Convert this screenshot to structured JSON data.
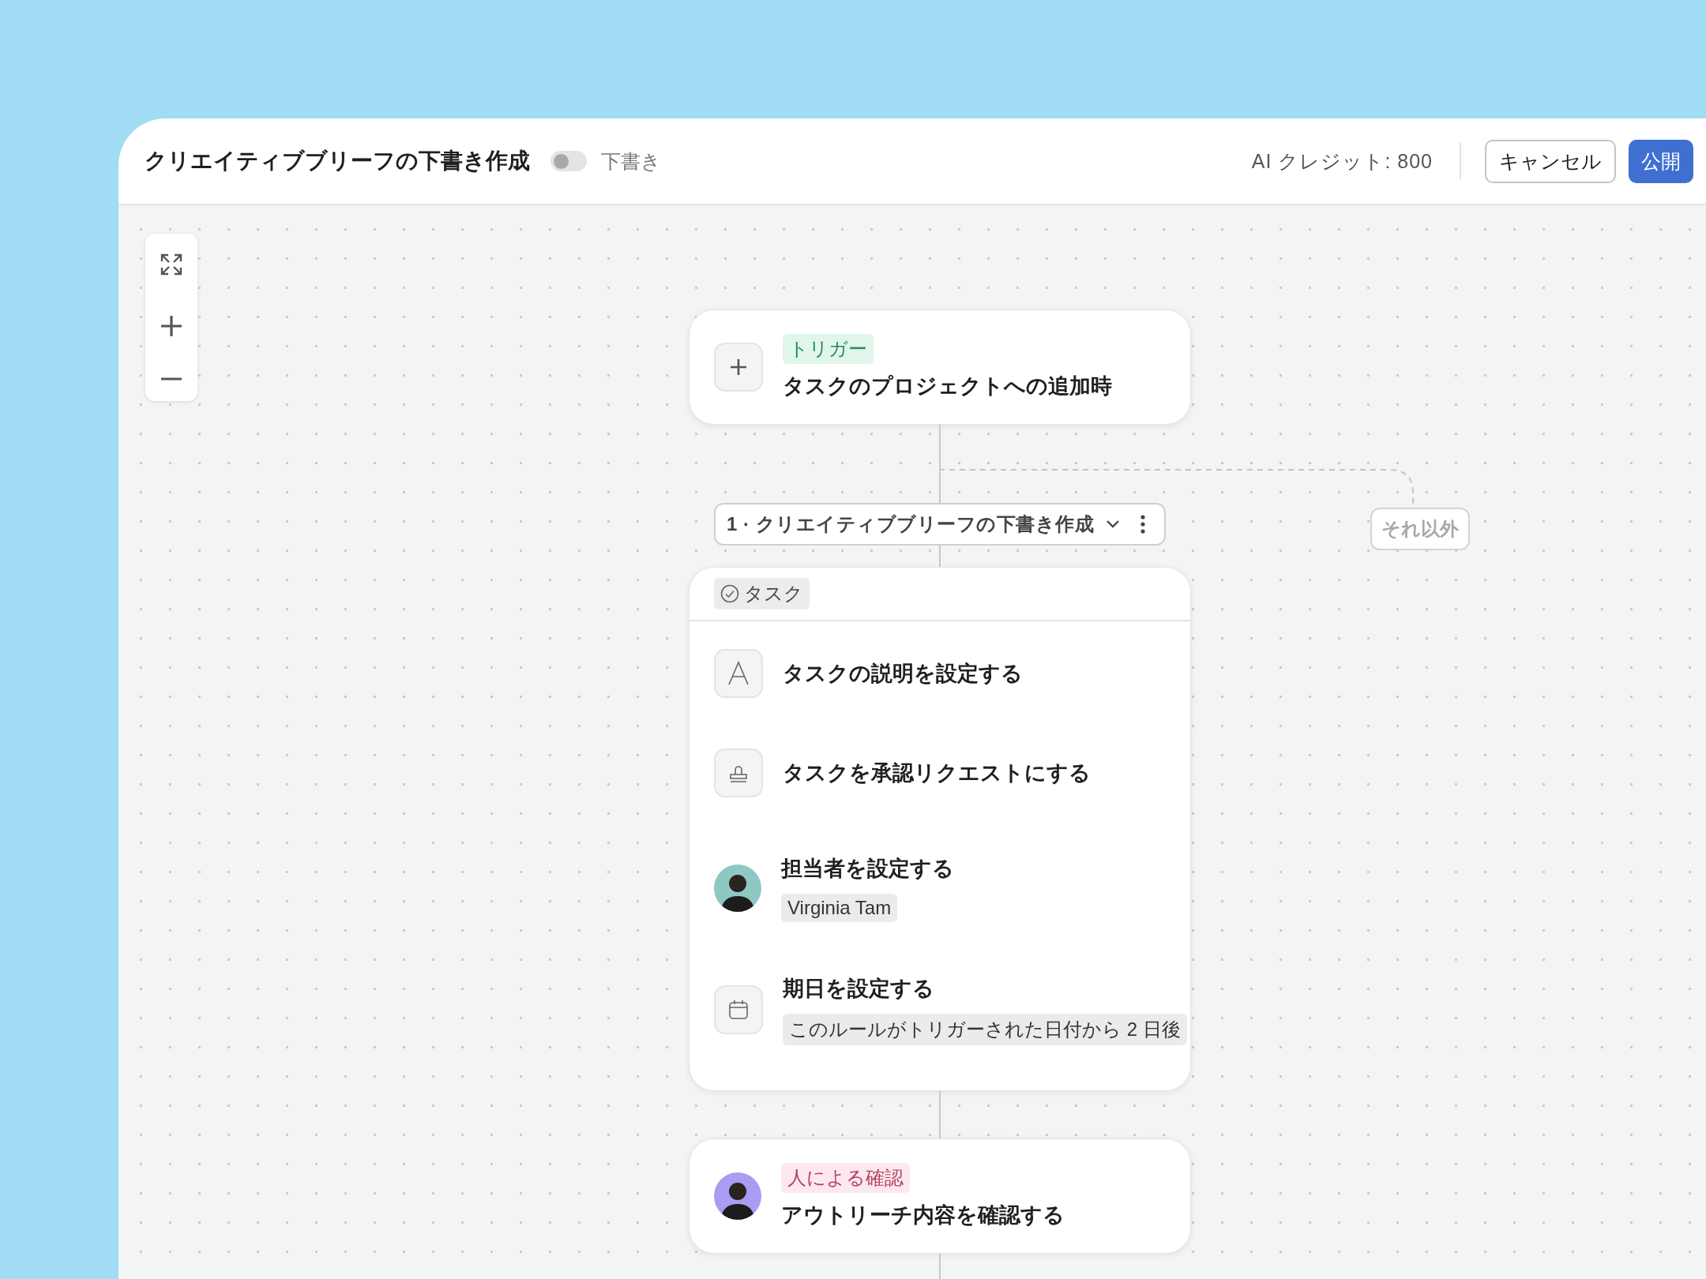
{
  "header": {
    "title": "クリエイティブブリーフの下書き作成",
    "draft_toggle": {
      "on": false
    },
    "status": "下書き",
    "credits": "AI クレジット: 800",
    "buttons": [
      {
        "label": "キャンセル",
        "kind": "secondary"
      },
      {
        "label": "公開",
        "kind": "primary"
      }
    ]
  },
  "trigger": {
    "badge": "トリガー",
    "title": "タスクのプロジェクトへの追加時"
  },
  "step": {
    "label": "1 · クリエイティブブリーフの下書き作成"
  },
  "branch": {
    "label": "それ以外"
  },
  "task_card": {
    "badge": "タスク",
    "actions": [
      {
        "kind": "text",
        "title": "タスクの説明を設定する"
      },
      {
        "kind": "approval",
        "title": "タスクを承認リクエストにする"
      },
      {
        "kind": "assignee",
        "title": "担当者を設定する",
        "value": "Virginia Tam"
      },
      {
        "kind": "due_date",
        "title": "期日を設定する",
        "value": "このルールがトリガーされた日付から 2 日後"
      }
    ]
  },
  "review": {
    "badge": "人による確認",
    "title": "アウトリーチ内容を確認する"
  }
}
